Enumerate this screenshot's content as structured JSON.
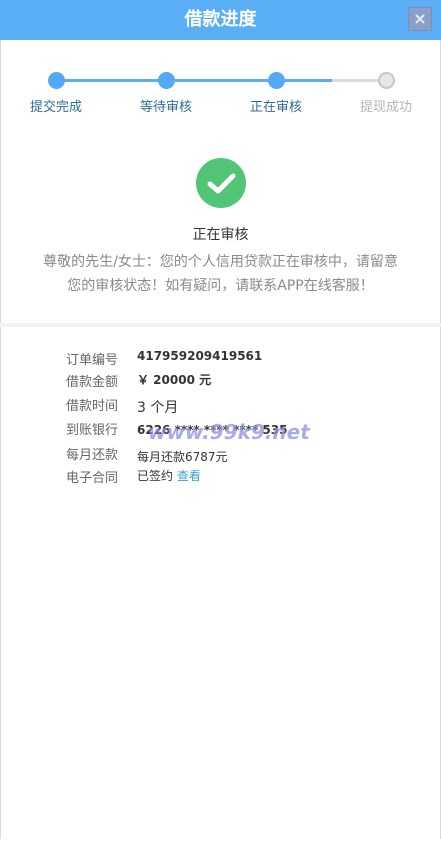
{
  "header": {
    "title": "借款进度",
    "close_label": "×"
  },
  "steps": [
    {
      "label": "提交完成",
      "state": "done"
    },
    {
      "label": "等待审核",
      "state": "done"
    },
    {
      "label": "正在审核",
      "state": "done"
    },
    {
      "label": "提现成功",
      "state": "todo"
    }
  ],
  "status": {
    "icon": "check-circle-icon",
    "title": "正在审核",
    "description": "尊敬的先生/女士：您的个人信用贷款正在审核中，请留意您的审核状态！如有疑问，请联系APP在线客服！"
  },
  "details": {
    "order_no_label": "订单编号",
    "order_no": "417959209419561",
    "amount_label": "借款金额",
    "amount": "￥ 20000 元",
    "term_label": "借款时间",
    "term": "3 个月",
    "bank_label": "到账银行",
    "bank": "6226 **** **** **** 535",
    "monthly_label": "每月还款",
    "monthly": "每月还款6787元",
    "contract_label": "电子合同",
    "contract_status": "已签约",
    "contract_link": "查看"
  },
  "watermark": "www.99k9.net",
  "colors": {
    "header": "#59aef5",
    "step_done": "#53a9f3",
    "step_todo": "#c7c7c7",
    "check": "#52c476",
    "link": "#3ca0d6"
  }
}
